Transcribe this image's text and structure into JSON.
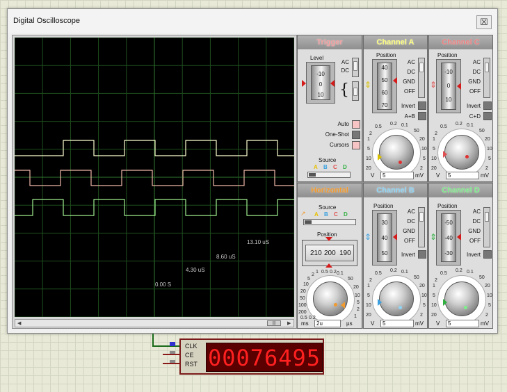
{
  "window": {
    "title": "Digital Oscilloscope",
    "close_glyph": "☒"
  },
  "screen": {
    "time_labels": [
      "13.10 uS",
      "8.60 uS",
      "4.30 uS",
      "0.00 S"
    ],
    "scroll_thumb_glyph": "|||",
    "scroll_left": "◀",
    "scroll_right": "▶"
  },
  "trigger": {
    "title": "Trigger",
    "level_label": "Level",
    "drum_ticks": [
      "-10",
      "0",
      "10"
    ],
    "coupling": [
      "AC",
      "DC"
    ],
    "edge_symbol": "{",
    "auto": "Auto",
    "one_shot": "One-Shot",
    "cursors": "Cursors",
    "source_label": "Source",
    "source_channels": [
      "A",
      "B",
      "C",
      "D"
    ]
  },
  "channel_a": {
    "title": "Channel A",
    "position_label": "Position",
    "drum_ticks": [
      "40",
      "50",
      "60",
      "70"
    ],
    "coupling": [
      "AC",
      "DC",
      "GND",
      "OFF"
    ],
    "invert": "Invert",
    "combine": "A+B",
    "dial_numbers": [
      "0.5",
      "0.2",
      "0.1",
      "50",
      "20",
      "10",
      "5",
      "2",
      "1",
      "20",
      "10",
      "5",
      "2"
    ],
    "scale_value": "5",
    "unit_left": "V",
    "unit_right": "mV"
  },
  "channel_c": {
    "title": "Channel C",
    "position_label": "Position",
    "drum_ticks": [
      "-10",
      "0",
      "10"
    ],
    "coupling": [
      "AC",
      "DC",
      "GND",
      "OFF"
    ],
    "invert": "Invert",
    "combine": "C+D",
    "dial_numbers": [
      "0.5",
      "0.2",
      "0.1",
      "50",
      "20",
      "10",
      "5",
      "2",
      "1",
      "20",
      "10",
      "5",
      "2"
    ],
    "scale_value": "5",
    "unit_left": "V",
    "unit_right": "mV"
  },
  "horizontal": {
    "title": "Horizontal",
    "source_label": "Source",
    "source_channels": [
      "A",
      "B",
      "C",
      "D"
    ],
    "position_label": "Position",
    "ruler_ticks": [
      "210",
      "200",
      "190"
    ],
    "dial_numbers": [
      "0.5",
      "0.2",
      "0.1",
      "50",
      "20",
      "10",
      "5",
      "2",
      "1",
      "200",
      "100",
      "50",
      "20",
      "10",
      "5",
      "2",
      "1",
      "0.5",
      "0.2"
    ],
    "scale_value": "2u",
    "unit_left": "ms",
    "unit_right": "µs"
  },
  "channel_b": {
    "title": "Channel B",
    "position_label": "Position",
    "drum_ticks": [
      "30",
      "40",
      "50"
    ],
    "coupling": [
      "AC",
      "DC",
      "GND",
      "OFF"
    ],
    "invert": "Invert",
    "dial_numbers": [
      "0.5",
      "0.2",
      "0.1",
      "50",
      "20",
      "10",
      "5",
      "2",
      "1",
      "20",
      "10",
      "5",
      "2"
    ],
    "scale_value": "5",
    "unit_left": "V",
    "unit_right": "mV"
  },
  "channel_d": {
    "title": "Channel D",
    "position_label": "Position",
    "drum_ticks": [
      "-50",
      "-40",
      "-30"
    ],
    "coupling": [
      "AC",
      "DC",
      "GND",
      "OFF"
    ],
    "invert": "Invert",
    "dial_numbers": [
      "0.5",
      "0.2",
      "0.1",
      "50",
      "20",
      "10",
      "5",
      "2",
      "1",
      "20",
      "10",
      "5",
      "2"
    ],
    "scale_value": "5",
    "unit_left": "V",
    "unit_right": "mV"
  },
  "counter": {
    "pins": [
      "CLK",
      "CE",
      "RST"
    ],
    "display": "00076495"
  },
  "colors": {
    "trigger": "#f4a0a0",
    "channel_a": "#ffff80",
    "channel_b": "#8fd4f5",
    "channel_c": "#f08080",
    "channel_d": "#7df08a",
    "horizontal": "#f09a30",
    "trace_a": "#ffffd0",
    "trace_c": "#f0b8a8",
    "trace_d": "#a0f090"
  }
}
